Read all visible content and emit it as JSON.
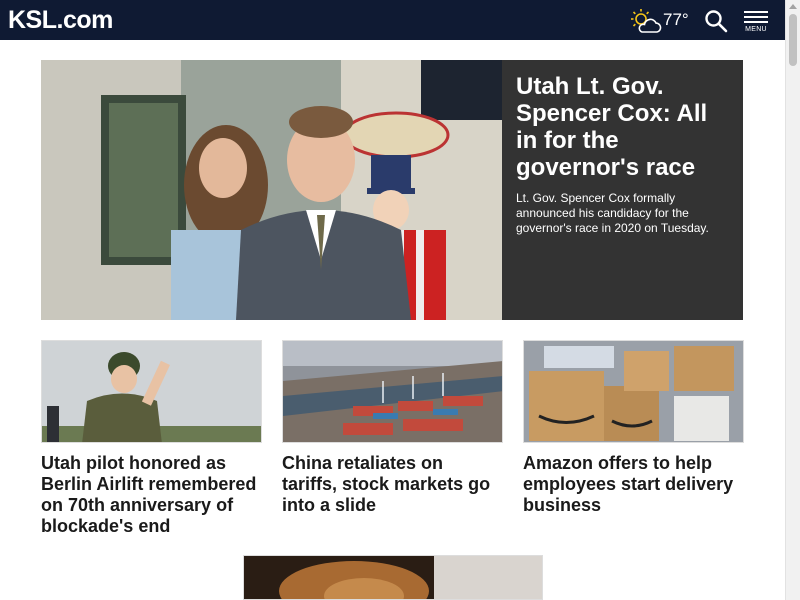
{
  "header": {
    "logo": "KSL.com",
    "weather_icon": "partly-cloudy-icon",
    "temperature": "77°",
    "menu_label": "MENU",
    "colors": {
      "background": "#0f1a33",
      "text": "#ffffff",
      "sun": "#f5c518"
    }
  },
  "hero": {
    "title": "Utah Lt. Gov. Spencer Cox: All in for the governor's race",
    "summary": "Lt. Gov. Spencer Cox formally announced his candidacy for the governor's race in 2020 on Tuesday.",
    "panel_color": "#333333"
  },
  "cards": [
    {
      "title": "Utah pilot honored as Berlin Airlift remembered on 70th anniversary of blockade's end"
    },
    {
      "title": "China retaliates on tariffs, stock markets go into a slide"
    },
    {
      "title": "Amazon offers to help employees start delivery business"
    }
  ]
}
